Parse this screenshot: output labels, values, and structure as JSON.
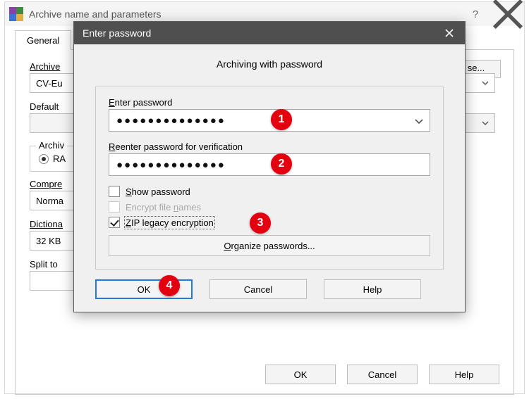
{
  "bg": {
    "title": "Archive name and parameters",
    "help_glyph": "?",
    "tab_general": "General",
    "archive_name_label": "Archive",
    "archive_name_value": "CV-Eu",
    "browse_label": "se...",
    "default_profile_label": "Default",
    "archive_format_group": "Archiv",
    "rar_option": "RA",
    "compression_label": "Compre",
    "compression_value": "Norma",
    "dictionary_label": "Dictiona",
    "dictionary_value": "32 KB",
    "split_label": "Split to",
    "ok": "OK",
    "cancel": "Cancel",
    "help": "Help"
  },
  "fg": {
    "title": "Enter password",
    "heading": "Archiving with password",
    "enter_label_pre": "",
    "enter_label_u": "E",
    "enter_label_post": "nter password",
    "enter_value": "●●●●●●●●●●●●●●",
    "reenter_label_u": "R",
    "reenter_label_post": "eenter password for verification",
    "reenter_value": "●●●●●●●●●●●●●●",
    "show_u": "S",
    "show_post": "how password",
    "encrypt_pre": "Encrypt file ",
    "encrypt_u": "n",
    "encrypt_post": "ames",
    "zip_u": "Z",
    "zip_post": "IP legacy encryption",
    "organize_u": "O",
    "organize_post": "rganize passwords...",
    "ok": "OK",
    "cancel": "Cancel",
    "help": "Help"
  },
  "markers": {
    "1": "1",
    "2": "2",
    "3": "3",
    "4": "4"
  }
}
